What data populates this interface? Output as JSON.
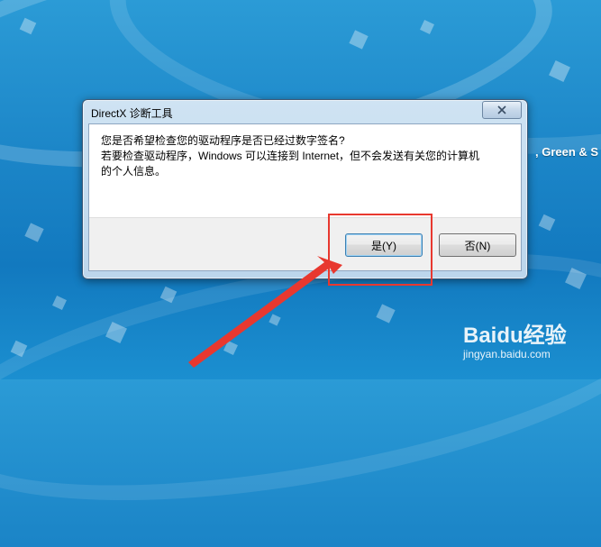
{
  "desktop": {
    "wallpaper_text": ", Green & S"
  },
  "dialog": {
    "title": "DirectX 诊断工具",
    "message_lines": [
      "您是否希望检查您的驱动程序是否已经过数字签名?",
      "若要检查驱动程序，Windows 可以连接到 Internet，但不会发送有关您的计算机",
      "的个人信息。"
    ],
    "buttons": {
      "yes": "是(Y)",
      "no": "否(N)"
    }
  },
  "watermark": {
    "logo": "Baidu经验",
    "url": "jingyan.baidu.com"
  },
  "colors": {
    "annotation": "#e8382f",
    "wallpaper": "#1c86c8"
  }
}
